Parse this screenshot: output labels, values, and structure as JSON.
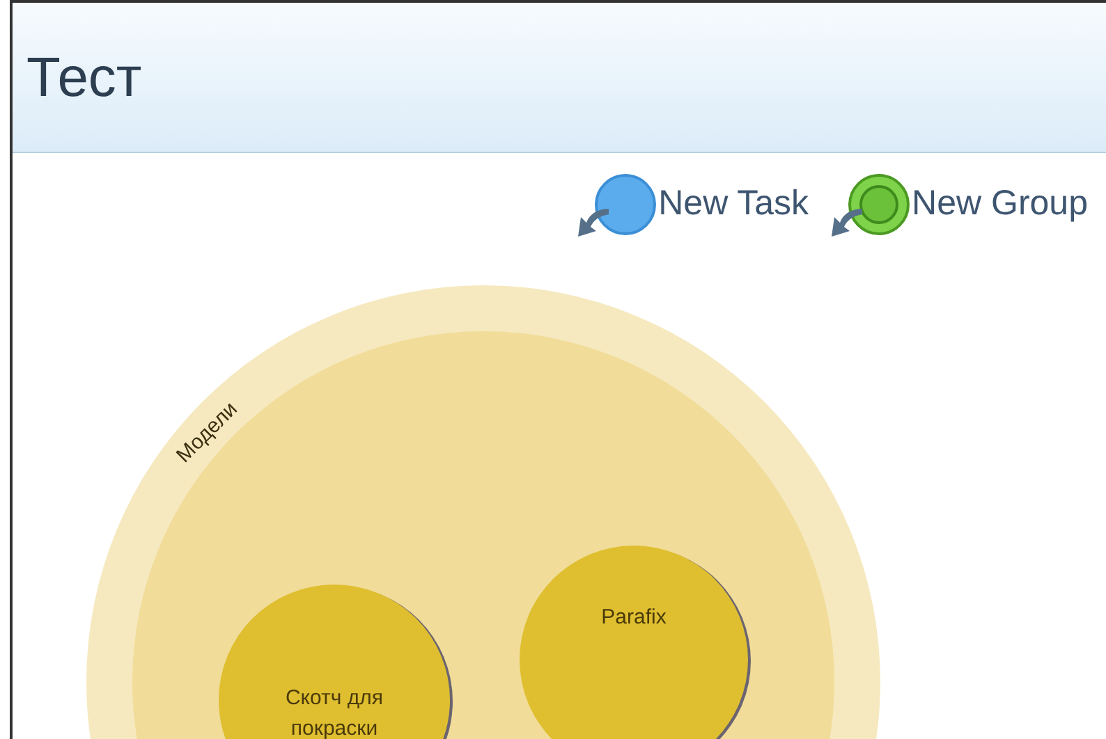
{
  "title": "Тест",
  "actions": [
    {
      "label": "New Task",
      "kind": "task"
    },
    {
      "label": "New Group",
      "kind": "group"
    }
  ],
  "groups": [
    {
      "name": "Модели",
      "tasks": [
        {
          "name": "Скотч для покраски"
        },
        {
          "name": "Parafix"
        }
      ]
    }
  ]
}
